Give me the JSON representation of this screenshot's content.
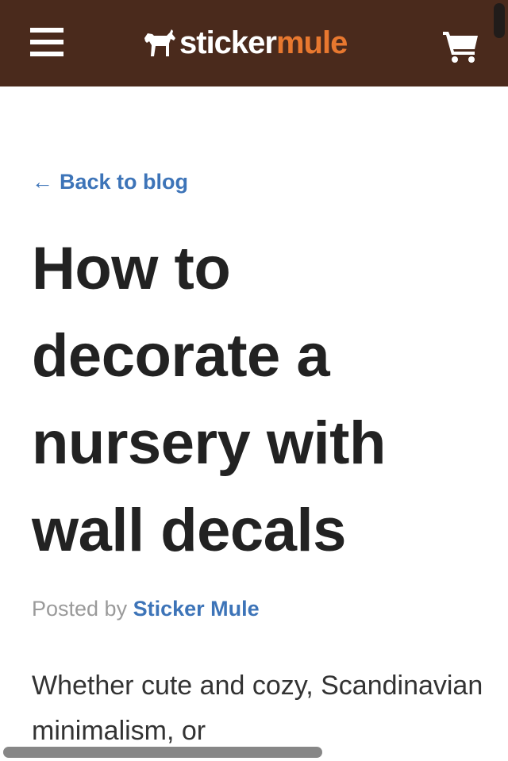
{
  "header": {
    "brand_left": "sticker",
    "brand_right": "mule",
    "menu_icon": "hamburger-icon",
    "cart_icon": "shopping-cart-icon",
    "logo_icon": "horse-icon",
    "colors": {
      "header_bg": "#4a2a1c",
      "brand_accent": "#e8782f"
    }
  },
  "nav": {
    "back_arrow": "←",
    "back_label": "Back to blog"
  },
  "article": {
    "title": "How to decorate a nursery with wall decals",
    "posted_by_label": "Posted by",
    "author": "Sticker Mule",
    "intro": "Whether cute and cozy, Scandinavian minimalism, or"
  },
  "colors": {
    "link": "#3d74b8",
    "title": "#222222",
    "byline": "#9a9a9a"
  }
}
